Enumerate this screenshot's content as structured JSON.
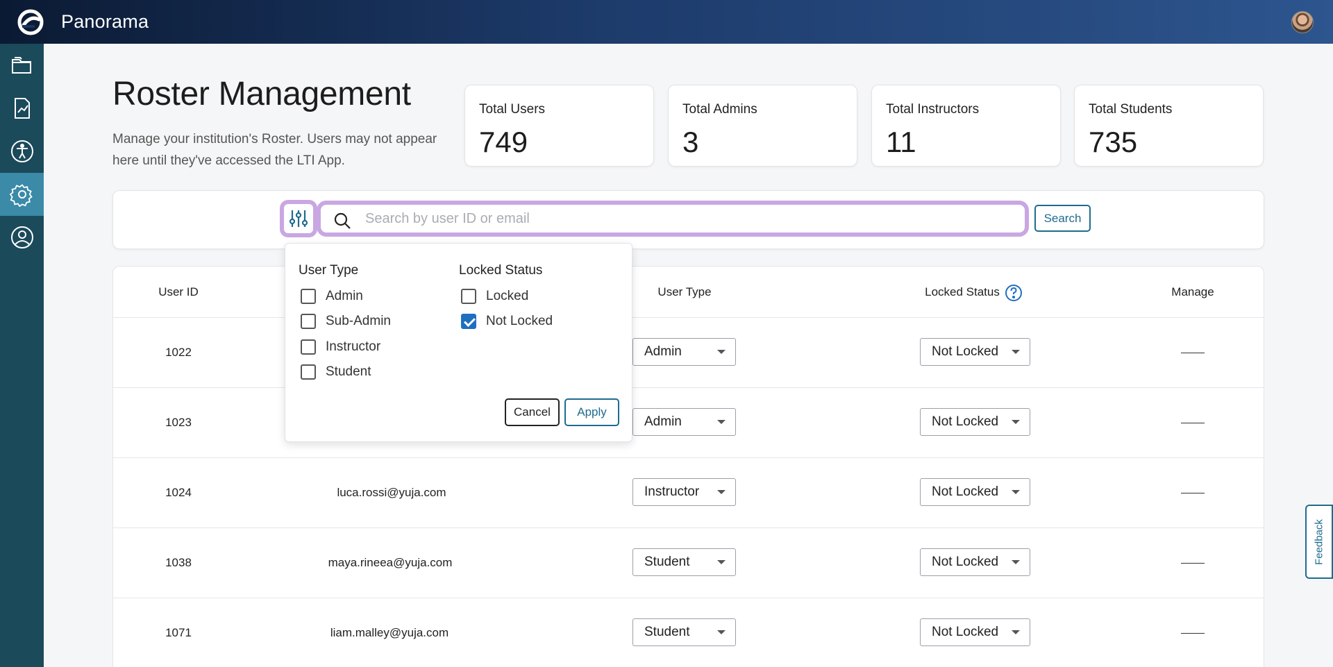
{
  "app": {
    "name": "Panorama"
  },
  "sidebar": {
    "items": [
      {
        "icon": "folder-icon"
      },
      {
        "icon": "report-icon"
      },
      {
        "icon": "accessibility-icon"
      },
      {
        "icon": "settings-icon",
        "active": true
      },
      {
        "icon": "user-profile-icon"
      }
    ]
  },
  "header": {
    "title": "Roster Management",
    "description": "Manage your institution's Roster. Users may not appear here until they've accessed the LTI App."
  },
  "stats": [
    {
      "label": "Total Users",
      "value": "749"
    },
    {
      "label": "Total Admins",
      "value": "3"
    },
    {
      "label": "Total Instructors",
      "value": "11"
    },
    {
      "label": "Total Students",
      "value": "735"
    }
  ],
  "search": {
    "placeholder": "Search by user ID or email",
    "value": "",
    "button_label": "Search"
  },
  "table": {
    "headers": {
      "user_id": "User ID",
      "user_type": "User Type",
      "locked_status": "Locked Status",
      "manage": "Manage"
    },
    "rows": [
      {
        "user_id": "1022",
        "email": "",
        "user_type": "Admin",
        "locked": "Not Locked",
        "manage": ""
      },
      {
        "user_id": "1023",
        "email": "",
        "user_type": "Admin",
        "locked": "Not Locked",
        "manage": ""
      },
      {
        "user_id": "1024",
        "email": "luca.rossi@yuja.com",
        "user_type": "Instructor",
        "locked": "Not Locked",
        "manage": ""
      },
      {
        "user_id": "1038",
        "email": "maya.rineea@yuja.com",
        "user_type": "Student",
        "locked": "Not Locked",
        "manage": ""
      },
      {
        "user_id": "1071",
        "email": "liam.malley@yuja.com",
        "user_type": "Student",
        "locked": "Not Locked",
        "manage": ""
      }
    ]
  },
  "filter_popover": {
    "user_type_heading": "User Type",
    "user_type_options": [
      {
        "label": "Admin",
        "checked": false
      },
      {
        "label": "Sub-Admin",
        "checked": false
      },
      {
        "label": "Instructor",
        "checked": false
      },
      {
        "label": "Student",
        "checked": false
      }
    ],
    "locked_heading": "Locked Status",
    "locked_options": [
      {
        "label": "Locked",
        "checked": false
      },
      {
        "label": "Not Locked",
        "checked": true
      }
    ],
    "cancel_label": "Cancel",
    "apply_label": "Apply"
  },
  "feedback": {
    "label": "Feedback"
  },
  "colors": {
    "accent": "#1e6b8f",
    "highlight": "#c9a7e2",
    "sidebar": "#1b4a5a",
    "sidebar_active": "#3a8aa8"
  }
}
